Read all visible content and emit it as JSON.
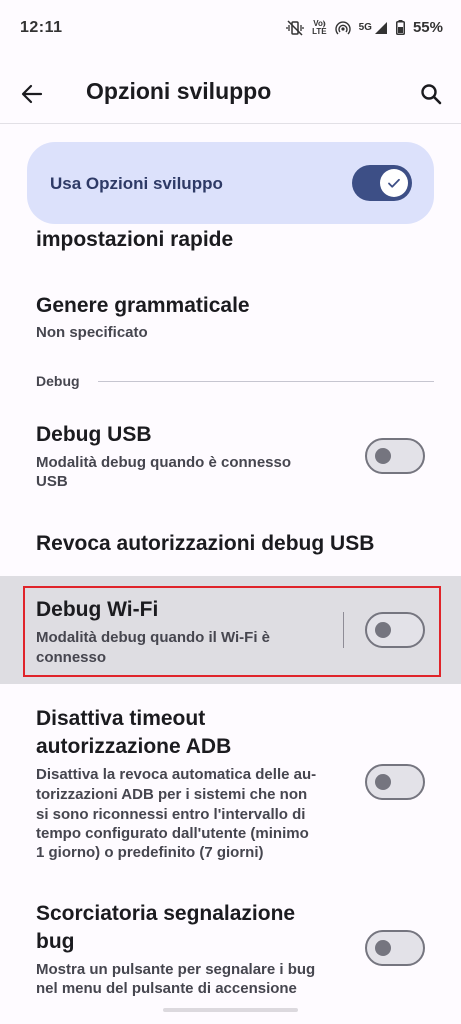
{
  "status": {
    "time": "12:11",
    "volte": "Vo)\nLTE",
    "network": "5G",
    "battery": "55%"
  },
  "header": {
    "title": "Opzioni sviluppo"
  },
  "master": {
    "label": "Usa Opzioni sviluppo",
    "enabled": true
  },
  "partial_item": {
    "title_line2": "impostazioni rapide"
  },
  "settings": {
    "grammatical": {
      "title": "Genere grammaticale",
      "subtitle": "Non specificato"
    },
    "section_debug": "Debug",
    "usb_debug": {
      "title": "Debug USB",
      "subtitle_l1": "Modalità debug quando è connesso",
      "subtitle_l2": "USB",
      "enabled": false
    },
    "revoke": {
      "title": "Revoca autorizzazioni debug USB"
    },
    "wifi_debug": {
      "title": "Debug Wi-Fi",
      "subtitle_l1": "Modalità debug quando il Wi-Fi è",
      "subtitle_l2": "connesso",
      "enabled": false
    },
    "adb_timeout": {
      "title_l1": "Disattiva timeout",
      "title_l2": "autorizzazione ADB",
      "sub_l1": "Disattiva la revoca automatica delle au-",
      "sub_l2": "torizzazioni ADB per i sistemi che non",
      "sub_l3": "si sono riconnessi entro l'intervallo di",
      "sub_l4": "tempo configurato dall'utente (minimo",
      "sub_l5": "1 giorno) o predefinito (7 giorni)",
      "enabled": false
    },
    "bug_shortcut": {
      "title_l1": "Scorciatoria segnalazione",
      "title_l2": "bug",
      "sub_l1": "Mostra un pulsante per segnalare i bug",
      "sub_l2": "nel menu del pulsante di accensione",
      "enabled": false
    }
  }
}
